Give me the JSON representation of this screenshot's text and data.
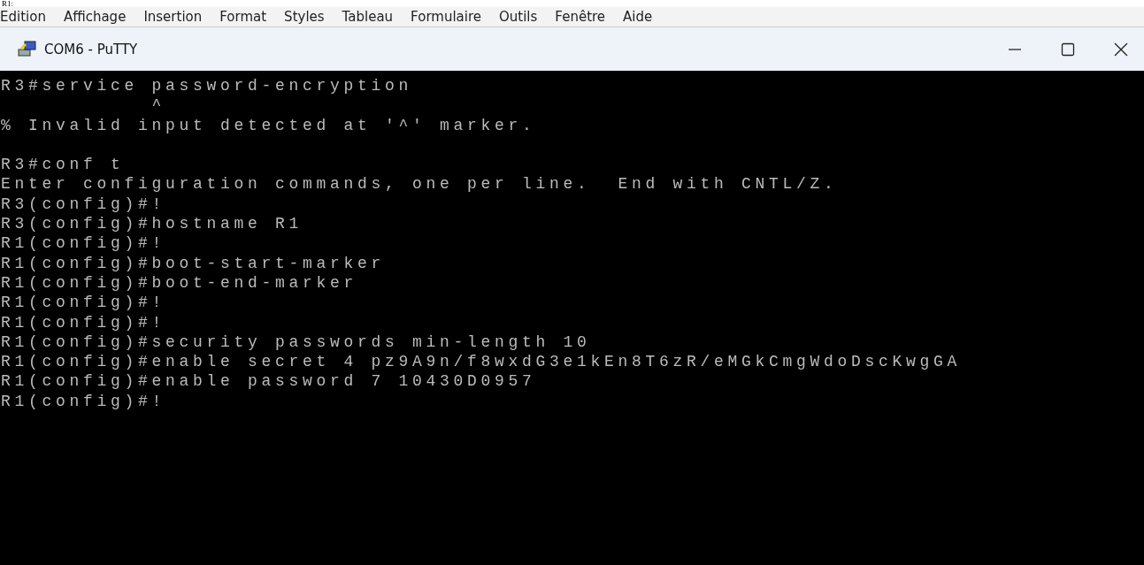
{
  "document_text": "R1:",
  "menu": [
    "Edition",
    "Affichage",
    "Insertion",
    "Format",
    "Styles",
    "Tableau",
    "Formulaire",
    "Outils",
    "Fenêtre",
    "Aide"
  ],
  "window": {
    "title": "COM6 - PuTTY"
  },
  "terminal": {
    "lines": [
      {
        "kind": "text",
        "text": "R3#service password-encryption"
      },
      {
        "kind": "text",
        "text": "           ^"
      },
      {
        "kind": "text",
        "text": "% Invalid input detected at '^' marker."
      },
      {
        "kind": "blank"
      },
      {
        "kind": "text",
        "text": "R3#conf t"
      },
      {
        "kind": "text",
        "text": "Enter configuration commands, one per line.  End with CNTL/Z."
      },
      {
        "kind": "text",
        "text": "R3(config)#!"
      },
      {
        "kind": "text",
        "text": "R3(config)#hostname R1"
      },
      {
        "kind": "text",
        "text": "R1(config)#!"
      },
      {
        "kind": "text",
        "text": "R1(config)#boot-start-marker"
      },
      {
        "kind": "text",
        "text": "R1(config)#boot-end-marker"
      },
      {
        "kind": "text",
        "text": "R1(config)#!"
      },
      {
        "kind": "text",
        "text": "R1(config)#!"
      },
      {
        "kind": "text",
        "text": "R1(config)#security passwords min-length 10"
      },
      {
        "kind": "text",
        "text": "R1(config)#enable secret 4 pz9A9n/f8wxdG3e1kEn8T6zR/eMGkCmgWdoDscKwgGA"
      },
      {
        "kind": "text",
        "text": "R1(config)#enable password 7 10430D0957"
      },
      {
        "kind": "text",
        "text": "R1(config)#!"
      }
    ]
  }
}
